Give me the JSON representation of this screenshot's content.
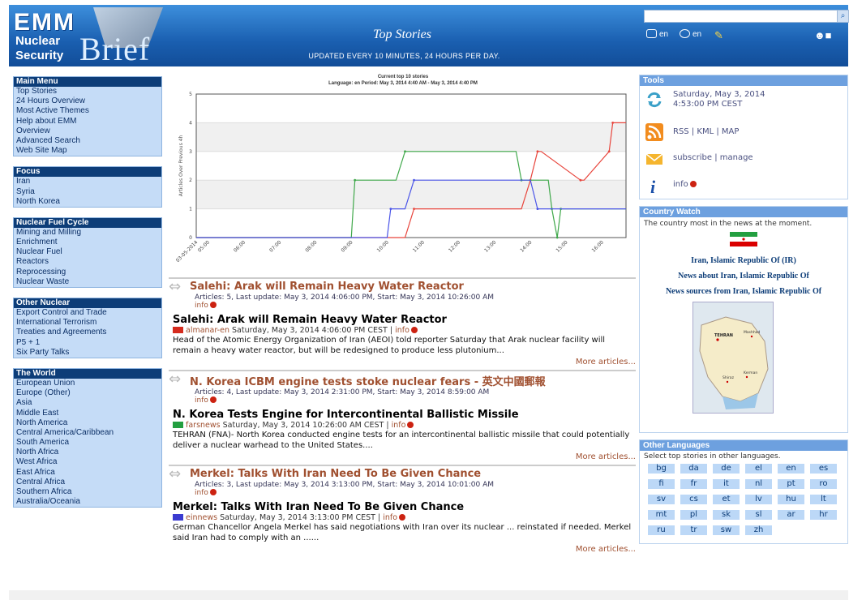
{
  "banner": {
    "logo_emm": "EMM",
    "logo_nuclear": "Nuclear",
    "logo_security": "Security",
    "logo_brief": "Brief",
    "title": "Top Stories",
    "subtitle": "Updated every 10 minutes, 24 hours per day.",
    "lang_label_1": "en",
    "lang_label_2": "en",
    "search_placeholder": ""
  },
  "left_menus": [
    {
      "header": "Main Menu",
      "items": [
        "Top Stories",
        "24 Hours Overview",
        "Most Active Themes",
        "Help about EMM",
        "Overview",
        "Advanced Search",
        "Web Site Map"
      ]
    },
    {
      "header": "Focus",
      "items": [
        "Iran",
        "Syria",
        "North Korea"
      ]
    },
    {
      "header": "Nuclear Fuel Cycle",
      "items": [
        "Mining and Milling",
        "Enrichment",
        "Nuclear Fuel",
        "Reactors",
        "Reprocessing",
        "Nuclear Waste"
      ]
    },
    {
      "header": "Other Nuclear",
      "items": [
        "Export Control and Trade",
        "International Terrorism",
        "Treaties and Agreements",
        "P5 + 1",
        "Six Party Talks"
      ]
    },
    {
      "header": "The World",
      "items": [
        "European Union",
        "Europe (Other)",
        "Asia",
        "Middle East",
        "North America",
        "Central America/Caribbean",
        "South America",
        "North Africa",
        "West Africa",
        "East Africa",
        "Central Africa",
        "Southern Africa",
        "Australia/Oceania"
      ]
    }
  ],
  "chart_data": {
    "type": "line",
    "title": "Current top 10 stories",
    "subtitle": "Language: en Period: May 3, 2014 4:40 AM - May 3, 2014 4:40 PM",
    "ylabel": "Articles Over Previous 4h",
    "xlabel": "",
    "ylim": [
      0,
      5
    ],
    "y_ticks": [
      "0",
      "1",
      "2",
      "3",
      "4",
      "5"
    ],
    "x_ticks": [
      "03-05-2014",
      "05:00",
      "06:00",
      "07:00",
      "08:00",
      "09:00",
      "10:00",
      "11:00",
      "12:00",
      "13:00",
      "14:00",
      "15:00",
      "16:00"
    ],
    "xlim": [
      4.67,
      16.67
    ],
    "grid": true,
    "series": [
      {
        "color": "#e8453c",
        "x": [
          4.67,
          10.5,
          10.75,
          13.75,
          14.0,
          14.2,
          14.3,
          15.4,
          15.5,
          16.2,
          16.3,
          16.67
        ],
        "y": [
          0,
          0,
          1,
          1,
          2,
          3,
          3,
          2,
          2,
          3,
          4,
          4
        ]
      },
      {
        "color": "#3fa84a",
        "x": [
          4.67,
          9.0,
          9.1,
          10.25,
          10.5,
          13.6,
          13.75,
          14.5,
          14.6,
          14.75,
          14.85,
          16.67
        ],
        "y": [
          0,
          0,
          2,
          2,
          3,
          3,
          2,
          2,
          1,
          0,
          1,
          1
        ]
      },
      {
        "color": "#4b55e8",
        "x": [
          4.67,
          10.0,
          10.1,
          10.5,
          10.75,
          14.0,
          14.2,
          15.0,
          15.1,
          16.67
        ],
        "y": [
          0,
          0,
          1,
          1,
          2,
          2,
          1,
          1,
          1,
          1
        ]
      }
    ]
  },
  "stories": [
    {
      "title": "Salehi: Arak will Remain Heavy Water Reactor",
      "meta": "Articles: 5, Last update: May 3, 2014 4:06:00 PM, Start: May 3, 2014 10:26:00 AM",
      "info": "info",
      "article_title": "Salehi: Arak will Remain Heavy Water Reactor",
      "flag_color": "#d52b1e",
      "source": "almanar-en",
      "date": "Saturday, May 3, 2014 4:06:00 PM CEST",
      "sep": "|",
      "a_info": "info",
      "text": "Head of the Atomic Energy Organization of Iran (AEOI) told reporter Saturday that Arak nuclear facility will remain a heavy water reactor, but will be redesigned to produce less plutonium...",
      "more": "More articles..."
    },
    {
      "title": "N. Korea ICBM engine tests stoke nuclear fears - 英文中國郵報",
      "meta": "Articles: 4, Last update: May 3, 2014 2:31:00 PM, Start: May 3, 2014 8:59:00 AM",
      "info": "info",
      "article_title": "N. Korea Tests Engine for Intercontinental Ballistic Missile",
      "flag_color": "#239f40",
      "source": "farsnews",
      "date": "Saturday, May 3, 2014 10:26:00 AM CEST",
      "sep": "|",
      "a_info": "info",
      "text": "TEHRAN (FNA)- North Korea conducted engine tests for an intercontinental ballistic missile that could potentially deliver a nuclear warhead to the United States....",
      "more": "More articles..."
    },
    {
      "title": "Merkel: Talks With Iran Need To Be Given Chance",
      "meta": "Articles: 3, Last update: May 3, 2014 3:13:00 PM, Start: May 3, 2014 10:01:00 AM",
      "info": "info",
      "article_title": "Merkel: Talks With Iran Need To Be Given Chance",
      "flag_color": "#3b3bd0",
      "source": "einnews",
      "date": "Saturday, May 3, 2014 3:13:00 PM CEST",
      "sep": "|",
      "a_info": "info",
      "text": "German Chancellor Angela Merkel has said negotiations with Iran over its nuclear ... reinstated if needed. Merkel said Iran had to comply with an ......",
      "more": "More articles..."
    }
  ],
  "tools": {
    "header": "Tools",
    "date": "Saturday, May 3, 2014",
    "time": "4:53:00 PM CEST",
    "rss": "RSS",
    "kml": "KML",
    "map": "MAP",
    "sep": "|",
    "subscribe": "subscribe",
    "manage": "manage",
    "info": "info"
  },
  "country_watch": {
    "header": "Country Watch",
    "intro": "The country most in the news at the moment.",
    "country": "Iran, Islamic Republic Of (IR)",
    "news_about": "News about Iran, Islamic Republic Of",
    "news_sources": "News sources from Iran, Islamic Republic Of",
    "map_labels": [
      "TEHRAN",
      "Mashhad",
      "Kerman",
      "Shiraz"
    ]
  },
  "other_languages": {
    "header": "Other Languages",
    "intro": "Select top stories in other languages.",
    "langs": [
      "bg",
      "da",
      "de",
      "el",
      "en",
      "es",
      "fi",
      "fr",
      "it",
      "nl",
      "pt",
      "ro",
      "sv",
      "cs",
      "et",
      "lv",
      "hu",
      "lt",
      "mt",
      "pl",
      "sk",
      "sl",
      "ar",
      "hr",
      "ru",
      "tr",
      "sw",
      "zh"
    ]
  },
  "colors": {
    "banner": "#1a5fb0",
    "menu_header": "#0d3d78",
    "menu_bg": "#c5dcf7",
    "panel_header": "#6da0df",
    "story_title": "#a05030"
  }
}
